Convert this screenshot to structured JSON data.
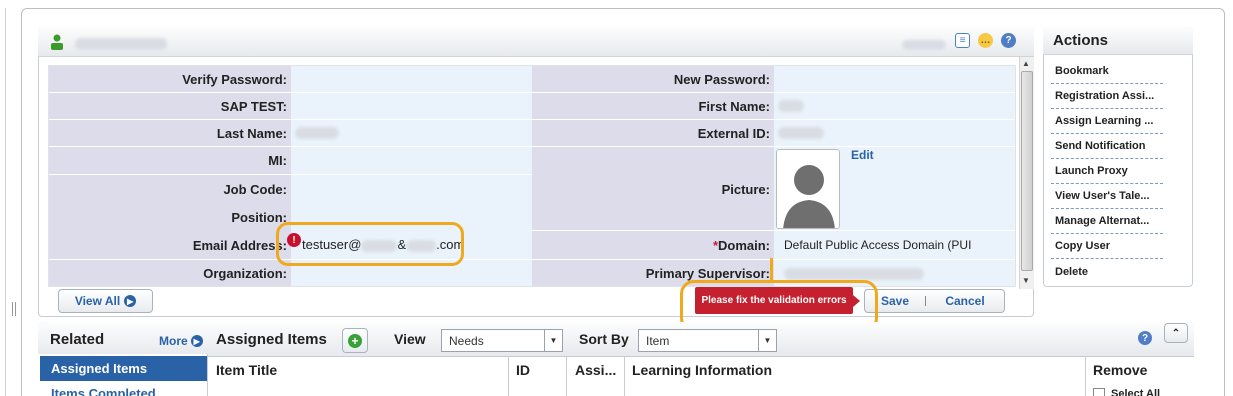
{
  "user_panel": {
    "header_icons": [
      "details-icon",
      "comment-icon",
      "help-icon"
    ],
    "fields": [
      {
        "left_label": "Verify Password:",
        "left_value": "",
        "right_label": "New Password:",
        "right_value": ""
      },
      {
        "left_label": "SAP TEST:",
        "left_value": "",
        "right_label": "First Name:",
        "right_value": ""
      },
      {
        "left_label": "Last Name:",
        "left_value": "",
        "right_label": "External ID:",
        "right_value": ""
      },
      {
        "left_label": "MI:",
        "left_value": "",
        "right_label": "",
        "right_value": ""
      },
      {
        "left_label": "Job Code:",
        "left_value": "",
        "right_label": "Picture:",
        "right_value": ""
      },
      {
        "left_label": "Position:",
        "left_value": "",
        "right_label": "",
        "right_value": ""
      },
      {
        "left_label": "Email Address:",
        "left_value": "testuser@",
        "right_label": "Domain:",
        "right_value": "Default Public Access Domain (PUI"
      },
      {
        "left_label": "Organization:",
        "left_value": "",
        "right_label": "Primary Supervisor:",
        "right_value": ""
      }
    ],
    "email_parts": [
      "testuser@",
      "&",
      ".com"
    ],
    "required_marker": "*",
    "edit_link": "Edit",
    "view_all": "View All",
    "save": "Save",
    "cancel": "Cancel",
    "validation_tooltip": "Please fix the validation errors",
    "error_icon": "!"
  },
  "actions": {
    "title": "Actions",
    "items": [
      "Bookmark",
      "Registration Assi...",
      "Assign Learning ...",
      "Send Notification",
      "Launch Proxy",
      "View User's Tale...",
      "Manage Alternat...",
      "Copy User",
      "Delete"
    ]
  },
  "related": {
    "title": "Related",
    "more": "More",
    "items": [
      "Assigned Items",
      "Items Completed"
    ]
  },
  "assigned": {
    "title": "Assigned Items",
    "view_label": "View",
    "view_value": "Needs",
    "sort_label": "Sort By",
    "sort_value": "Item",
    "columns": [
      "Item Title",
      "ID",
      "Assi...",
      "Learning Information",
      "Remove"
    ],
    "select_all": "Select All"
  },
  "colors": {
    "accent": "#2a62a8",
    "highlight": "#f0a81c",
    "error": "#c5202f"
  }
}
